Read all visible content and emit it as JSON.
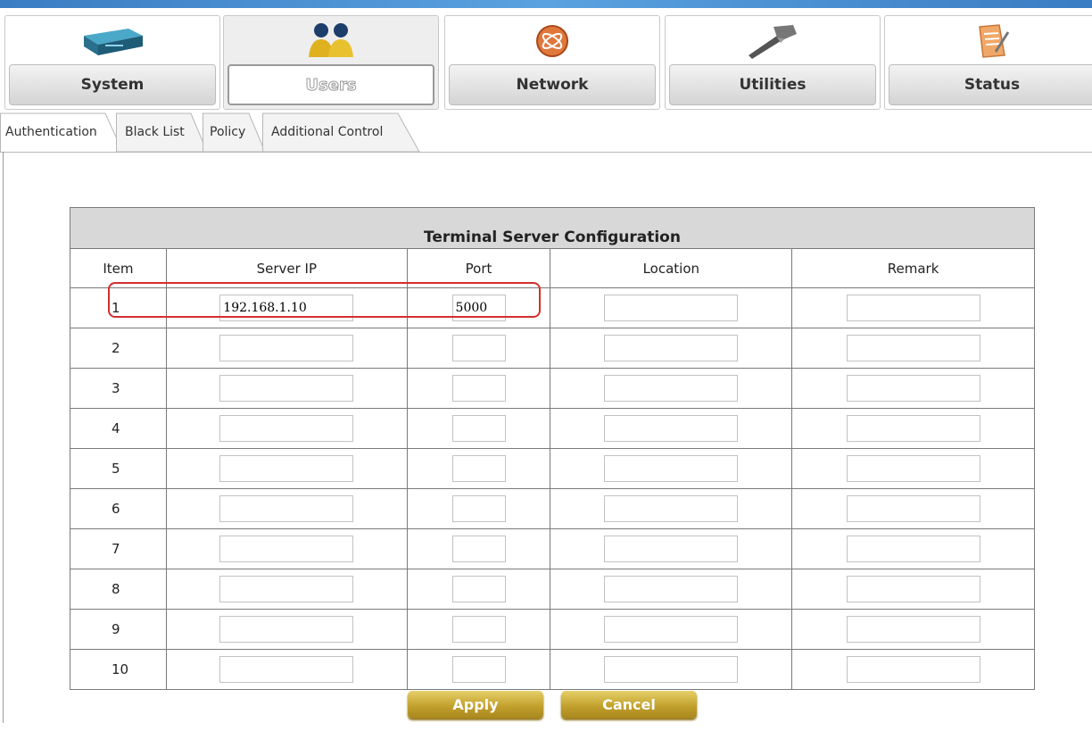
{
  "nav": {
    "items": [
      {
        "label": "System",
        "icon": "server-icon"
      },
      {
        "label": "Users",
        "icon": "users-icon",
        "active": true
      },
      {
        "label": "Network",
        "icon": "network-icon"
      },
      {
        "label": "Utilities",
        "icon": "hammer-icon"
      },
      {
        "label": "Status",
        "icon": "notepad-icon"
      }
    ]
  },
  "tabs": [
    "Authentication",
    "Black List",
    "Policy",
    "Additional Control"
  ],
  "table": {
    "title": "Terminal Server Configuration",
    "columns": [
      "Item",
      "Server IP",
      "Port",
      "Location",
      "Remark"
    ],
    "rows": [
      {
        "item": "1",
        "server_ip": "192.168.1.10",
        "port": "5000",
        "location": "",
        "remark": ""
      },
      {
        "item": "2",
        "server_ip": "",
        "port": "",
        "location": "",
        "remark": ""
      },
      {
        "item": "3",
        "server_ip": "",
        "port": "",
        "location": "",
        "remark": ""
      },
      {
        "item": "4",
        "server_ip": "",
        "port": "",
        "location": "",
        "remark": ""
      },
      {
        "item": "5",
        "server_ip": "",
        "port": "",
        "location": "",
        "remark": ""
      },
      {
        "item": "6",
        "server_ip": "",
        "port": "",
        "location": "",
        "remark": ""
      },
      {
        "item": "7",
        "server_ip": "",
        "port": "",
        "location": "",
        "remark": ""
      },
      {
        "item": "8",
        "server_ip": "",
        "port": "",
        "location": "",
        "remark": ""
      },
      {
        "item": "9",
        "server_ip": "",
        "port": "",
        "location": "",
        "remark": ""
      },
      {
        "item": "10",
        "server_ip": "",
        "port": "",
        "location": "",
        "remark": ""
      }
    ]
  },
  "buttons": {
    "apply": "Apply",
    "cancel": "Cancel"
  },
  "colors": {
    "topbar": "#3a7dc2",
    "highlight": "#d32f2f",
    "button_gold": "#c2a12d"
  }
}
